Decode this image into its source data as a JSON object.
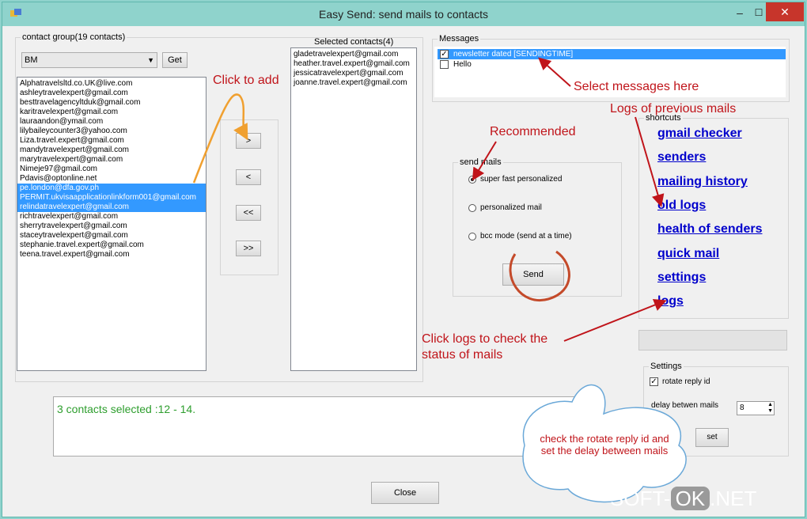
{
  "window": {
    "title": "Easy Send: send mails to contacts",
    "min": "–",
    "max": "☐",
    "close": "✕"
  },
  "contact_group": {
    "legend": "contact group(19 contacts)",
    "combo_value": "BM",
    "get_label": "Get",
    "contacts": [
      {
        "email": "Alphatravelsltd.co.UK@live.com",
        "selected": false
      },
      {
        "email": "ashleytravelexpert@gmail.com",
        "selected": false
      },
      {
        "email": "besttravelagencyltduk@gmail.com",
        "selected": false
      },
      {
        "email": "karitravelexpert@gmail.com",
        "selected": false
      },
      {
        "email": "lauraandon@ymail.com",
        "selected": false
      },
      {
        "email": "lilybaileycounter3@yahoo.com",
        "selected": false
      },
      {
        "email": "Liza.travel.expert@gmail.com",
        "selected": false
      },
      {
        "email": "mandytravelexpert@gmail.com",
        "selected": false
      },
      {
        "email": "marytravelexpert@gmail.com",
        "selected": false
      },
      {
        "email": "Nimeje97@gmail.com",
        "selected": false
      },
      {
        "email": "Pdavis@optonline.net",
        "selected": false
      },
      {
        "email": "pe.london@dfa.gov.ph",
        "selected": true
      },
      {
        "email": "PERMIT.ukvisaapplicationlinkform001@gmail.com",
        "selected": true
      },
      {
        "email": "relindatravelexpert@gmail.com",
        "selected": true
      },
      {
        "email": "richtravelexpert@gmail.com",
        "selected": false
      },
      {
        "email": "sherrytravelexpert@gmail.com",
        "selected": false
      },
      {
        "email": "staceytravelexpert@gmail.com",
        "selected": false
      },
      {
        "email": "stephanie.travel.expert@gmail.com",
        "selected": false
      },
      {
        "email": "teena.travel.expert@gmail.com",
        "selected": false
      }
    ]
  },
  "move_buttons": {
    "add": ">",
    "remove": "<",
    "remove_all": "<<",
    "add_all": ">>"
  },
  "selected_contacts": {
    "label": "Selected contacts(4)",
    "items": [
      "gladetravelexpert@gmail.com",
      "heather.travel.expert@gmail.com",
      "jessicatravelexpert@gmail.com",
      "joanne.travel.expert@gmail.com"
    ]
  },
  "messages": {
    "legend": "Messages",
    "items": [
      {
        "label": "newsletter dated [SENDINGTIME]",
        "checked": true,
        "selected": true
      },
      {
        "label": "Hello",
        "checked": false,
        "selected": false
      }
    ]
  },
  "send_mails": {
    "legend": "send mails",
    "options": [
      {
        "label": "super fast personalized",
        "checked": true
      },
      {
        "label": "personalized mail",
        "checked": false
      },
      {
        "label": "bcc mode (send at a time)",
        "checked": false
      }
    ],
    "send_label": "Send"
  },
  "shortcuts": {
    "legend": "shortcuts",
    "links": [
      "gmail checker",
      "senders",
      "mailing history",
      "old logs",
      "health of senders",
      "quick mail",
      "settings",
      "logs"
    ]
  },
  "settings": {
    "legend": "Settings",
    "rotate_label": "rotate reply id",
    "rotate_checked": true,
    "delay_label": "delay betwen mails",
    "delay_value": "8",
    "set_label": "set"
  },
  "status": {
    "text": "3 contacts selected :12 - 14.",
    "color": "#2e9e2e"
  },
  "close_label": "Close",
  "annotations": {
    "click_to_add": "Click to add",
    "select_messages": "Select messages here",
    "logs_previous": "Logs of previous mails",
    "recommended": "Recommended",
    "click_logs_1": "Click logs to check the",
    "click_logs_2": "status of mails",
    "cloud": "check the rotate reply id and set the delay between mails",
    "color": "#c0141a"
  },
  "watermark": {
    "left": "SOFT-",
    "mid": "OK",
    "right": ".NET"
  }
}
